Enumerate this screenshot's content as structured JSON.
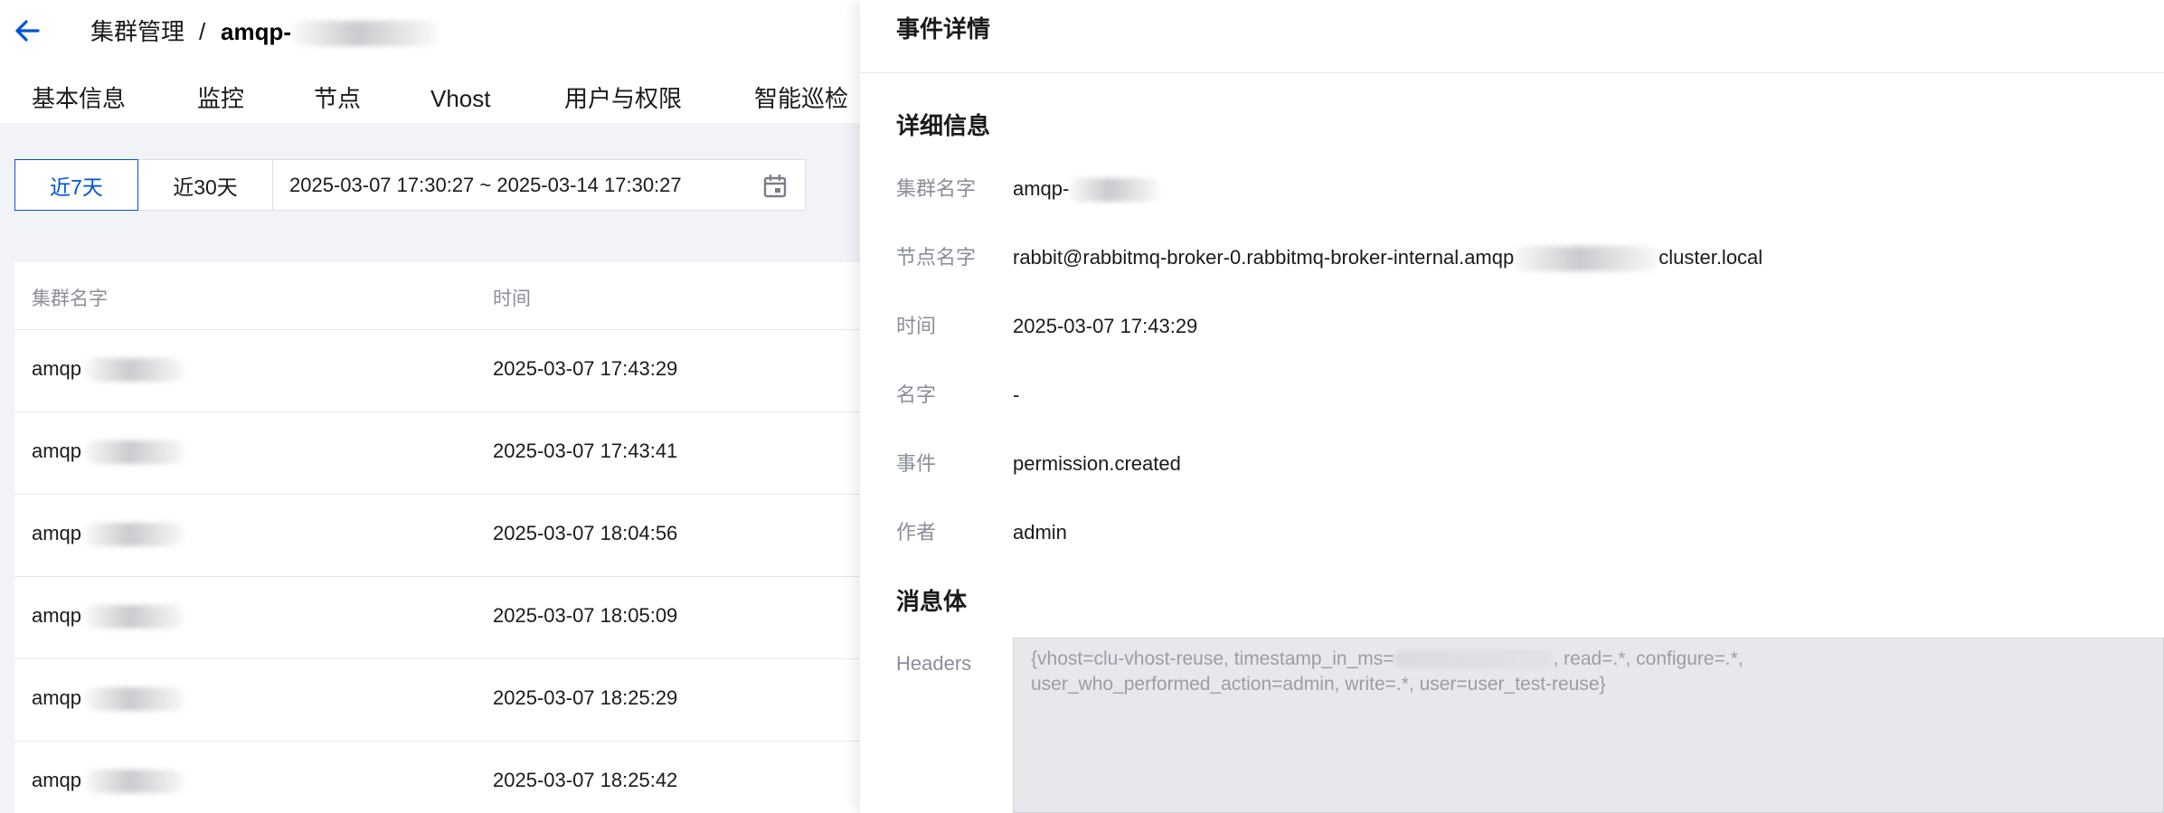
{
  "breadcrumb": {
    "parent": "集群管理",
    "separator": "/",
    "current": "amqp-"
  },
  "tabs": [
    {
      "label": "基本信息"
    },
    {
      "label": "监控"
    },
    {
      "label": "节点"
    },
    {
      "label": "Vhost"
    },
    {
      "label": "用户与权限"
    },
    {
      "label": "智能巡检"
    }
  ],
  "filter": {
    "range_7d": "近7天",
    "range_30d": "近30天",
    "date_range": "2025-03-07 17:30:27 ~ 2025-03-14 17:30:27",
    "selected": "近7天"
  },
  "table": {
    "columns": {
      "cluster_name": "集群名字",
      "time": "时间"
    },
    "rows": [
      {
        "cluster_name": "amqp",
        "time": "2025-03-07 17:43:29"
      },
      {
        "cluster_name": "amqp",
        "time": "2025-03-07 17:43:41"
      },
      {
        "cluster_name": "amqp",
        "time": "2025-03-07 18:04:56"
      },
      {
        "cluster_name": "amqp",
        "time": "2025-03-07 18:05:09"
      },
      {
        "cluster_name": "amqp",
        "time": "2025-03-07 18:25:29"
      },
      {
        "cluster_name": "amqp",
        "time": "2025-03-07 18:25:42"
      }
    ]
  },
  "drawer": {
    "title": "事件详情",
    "details_title": "详细信息",
    "fields": {
      "cluster_name": {
        "label": "集群名字",
        "value": "amqp-"
      },
      "node_name": {
        "label": "节点名字",
        "value_prefix": "rabbit@rabbitmq-broker-0.rabbitmq-broker-internal.amqp",
        "value_suffix": "cluster.local"
      },
      "time": {
        "label": "时间",
        "value": "2025-03-07 17:43:29"
      },
      "name": {
        "label": "名字",
        "value": "-"
      },
      "event": {
        "label": "事件",
        "value": "permission.created"
      },
      "author": {
        "label": "作者",
        "value": "admin"
      }
    },
    "message_title": "消息体",
    "headers": {
      "label": "Headers",
      "line1_prefix": "{vhost=clu-vhost-reuse, timestamp_in_ms=",
      "line1_suffix": ", read=.*, configure=.*,",
      "line2": "user_who_performed_action=admin, write=.*, user=user_test-reuse}"
    }
  },
  "colors": {
    "accent": "#0052d9",
    "page_bg": "#f2f3f7",
    "label_gray": "#8a8e99",
    "headers_bg": "#e7e8ec"
  },
  "icons": {
    "back": "arrow-left-icon",
    "calendar": "calendar-icon"
  }
}
